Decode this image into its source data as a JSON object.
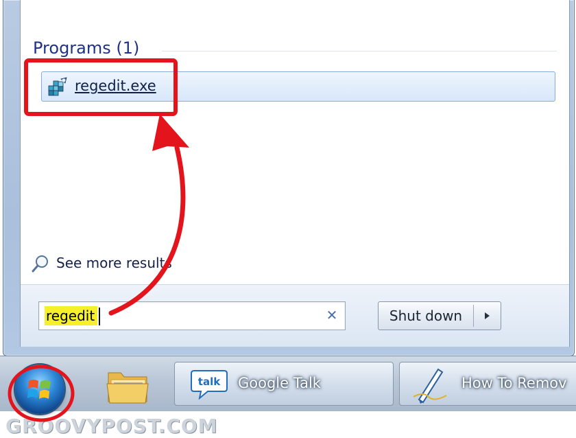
{
  "start_menu": {
    "section_title": "Programs (1)",
    "result_label": "regedit.exe",
    "see_more_label": "See more results",
    "search_value": "regedit",
    "shutdown_label": "Shut down"
  },
  "taskbar": {
    "items": [
      {
        "label": "Google Talk",
        "icon": "google-talk-icon"
      },
      {
        "label": "How To Remov",
        "icon": "pen-document-icon"
      }
    ]
  },
  "watermark": "GROOVYPOST.COM",
  "colors": {
    "annotation_red": "#e3141c",
    "highlight_yellow": "#f6f02a",
    "section_title": "#1e3287"
  },
  "icons": {
    "result": "registry-editor-icon",
    "see_more": "magnifier-icon",
    "clear": "clear-x-icon",
    "shutdown_arrow": "triangle-right-icon",
    "start": "windows-logo-icon",
    "pinned": "folder-icon"
  }
}
